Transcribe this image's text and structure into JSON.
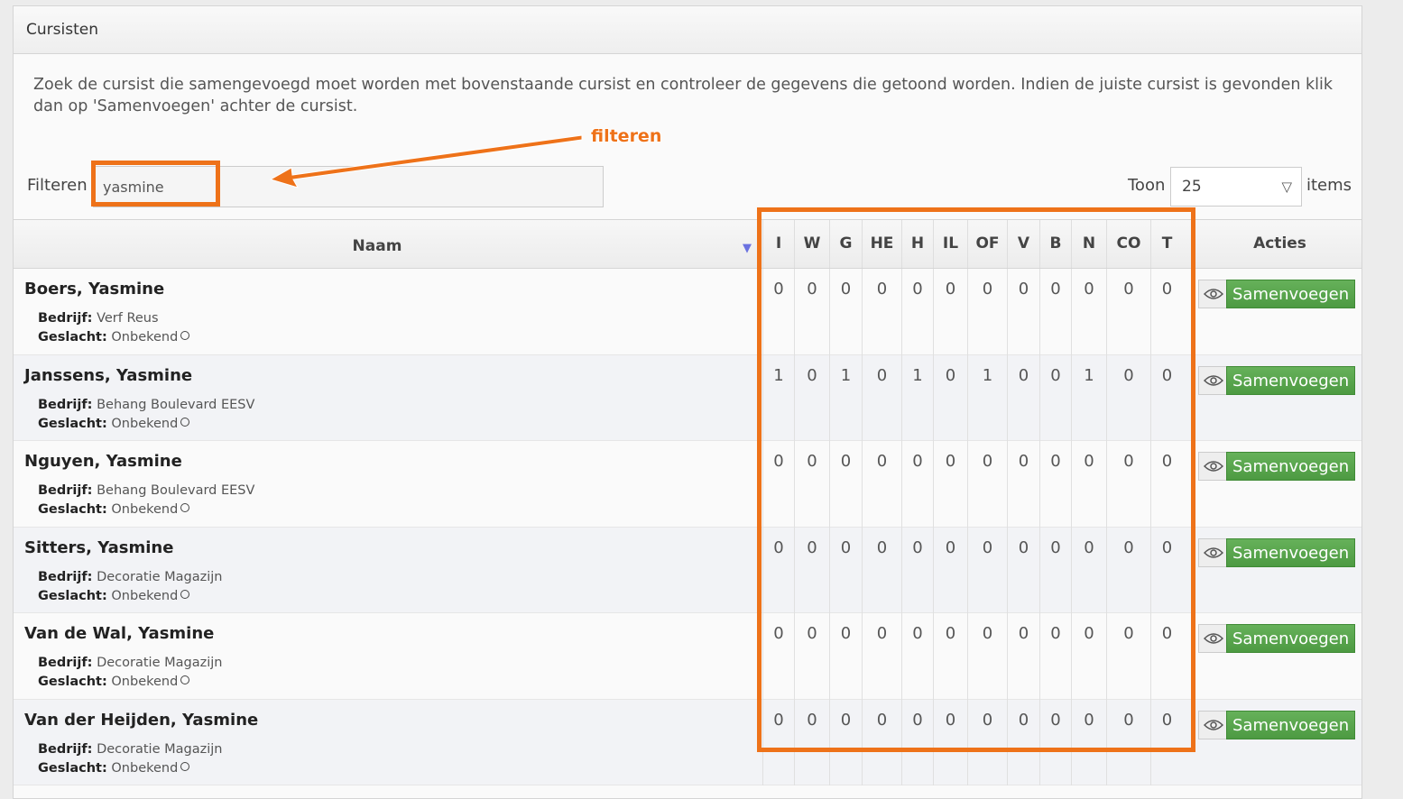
{
  "panel": {
    "title": "Cursisten",
    "intro": "Zoek de cursist die samengevoegd moet worden met bovenstaande cursist en controleer de gegevens die getoond worden. Indien de juiste cursist is gevonden klik dan op 'Samenvoegen' achter de cursist."
  },
  "filter": {
    "label": "Filteren",
    "value": "yasmine"
  },
  "pager": {
    "toon_label": "Toon",
    "selected": "25",
    "items_label": "items"
  },
  "table": {
    "naam_header": "Naam",
    "acties_header": "Acties",
    "columns": [
      "I",
      "W",
      "G",
      "HE",
      "H",
      "IL",
      "OF",
      "V",
      "B",
      "N",
      "CO",
      "T"
    ],
    "bedrijf_label": "Bedrijf:",
    "geslacht_label": "Geslacht:",
    "merge_label": "Samenvoegen",
    "rows": [
      {
        "name": "Boers, Yasmine",
        "bedrijf": "Verf Reus",
        "geslacht": "Onbekend",
        "values": [
          "0",
          "0",
          "0",
          "0",
          "0",
          "0",
          "0",
          "0",
          "0",
          "0",
          "0",
          "0"
        ]
      },
      {
        "name": "Janssens, Yasmine",
        "bedrijf": "Behang Boulevard EESV",
        "geslacht": "Onbekend",
        "values": [
          "1",
          "0",
          "1",
          "0",
          "1",
          "0",
          "1",
          "0",
          "0",
          "1",
          "0",
          "0"
        ]
      },
      {
        "name": "Nguyen, Yasmine",
        "bedrijf": "Behang Boulevard EESV",
        "geslacht": "Onbekend",
        "values": [
          "0",
          "0",
          "0",
          "0",
          "0",
          "0",
          "0",
          "0",
          "0",
          "0",
          "0",
          "0"
        ]
      },
      {
        "name": "Sitters, Yasmine",
        "bedrijf": "Decoratie Magazijn",
        "geslacht": "Onbekend",
        "values": [
          "0",
          "0",
          "0",
          "0",
          "0",
          "0",
          "0",
          "0",
          "0",
          "0",
          "0",
          "0"
        ]
      },
      {
        "name": "Van de Wal, Yasmine",
        "bedrijf": "Decoratie Magazijn",
        "geslacht": "Onbekend",
        "values": [
          "0",
          "0",
          "0",
          "0",
          "0",
          "0",
          "0",
          "0",
          "0",
          "0",
          "0",
          "0"
        ]
      },
      {
        "name": "Van der Heijden, Yasmine",
        "bedrijf": "Decoratie Magazijn",
        "geslacht": "Onbekend",
        "values": [
          "0",
          "0",
          "0",
          "0",
          "0",
          "0",
          "0",
          "0",
          "0",
          "0",
          "0",
          "0"
        ]
      }
    ]
  },
  "annotation": {
    "label": "filteren",
    "color": "#ee7219"
  },
  "colors": {
    "merge_button": "#4d9a42",
    "sort_icon": "#6b72e0"
  }
}
